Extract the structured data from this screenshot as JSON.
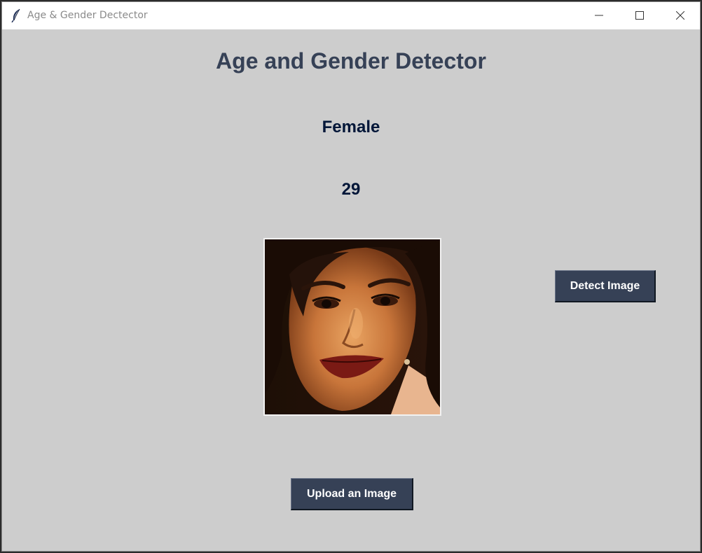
{
  "window": {
    "title": "Age & Gender Dectector",
    "app_icon": "feather-icon",
    "controls": {
      "minimize": "minimize-icon",
      "maximize": "maximize-icon",
      "close": "close-icon"
    }
  },
  "main": {
    "heading": "Age and Gender Detector",
    "gender_result": "Female",
    "age_result": "29",
    "image": "face-photo",
    "detect_button": "Detect Image",
    "upload_button": "Upload an Image"
  },
  "colors": {
    "background": "#cdcdcd",
    "heading": "#364156",
    "result_text": "#011638",
    "button_bg": "#364156",
    "button_text": "#ffffff"
  }
}
